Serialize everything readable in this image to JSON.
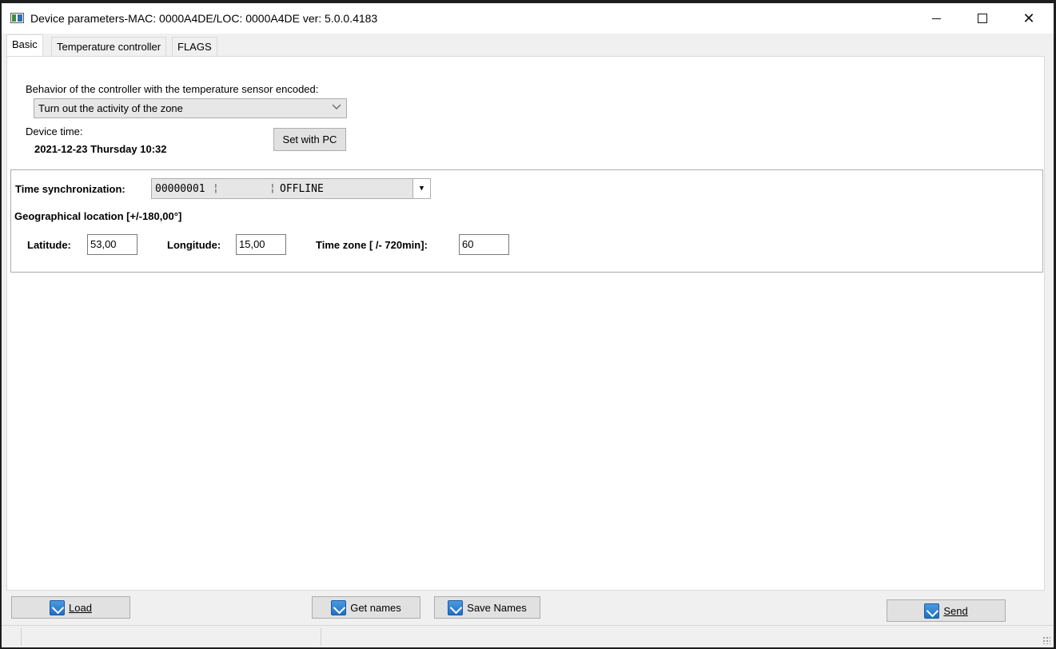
{
  "window": {
    "title": "Device parameters-MAC: 0000A4DE/LOC: 0000A4DE ver: 5.0.0.4183",
    "icon": "app-window-icon",
    "controls": {
      "minimize": "minimize-icon",
      "maximize": "maximize-icon",
      "close": "close-icon"
    }
  },
  "tabs": [
    {
      "label": "Basic",
      "active": true
    },
    {
      "label": "Temperature controller",
      "active": false
    },
    {
      "label": "FLAGS",
      "active": false
    }
  ],
  "basic": {
    "behavior_label": "Behavior of the controller with the temperature sensor encoded:",
    "behavior_value": "Turn out the activity of the zone",
    "device_time_label": "Device time:",
    "device_time_value": "2021-12-23 Thursday 10:32",
    "set_with_pc_label": "Set with PC"
  },
  "sync": {
    "label": "Time synchronization:",
    "id": "00000001",
    "status": "OFFLINE",
    "geo_label": "Geographical location [+/-180,00°]",
    "latitude_label": "Latitude:",
    "latitude_value": "53,00",
    "longitude_label": "Longitude:",
    "longitude_value": "15,00",
    "timezone_label": "Time zone [ /- 720min]:",
    "timezone_value": "60"
  },
  "buttons": {
    "load": "Load",
    "get_names": "Get names",
    "save_names": "Save Names",
    "send": "Send"
  }
}
